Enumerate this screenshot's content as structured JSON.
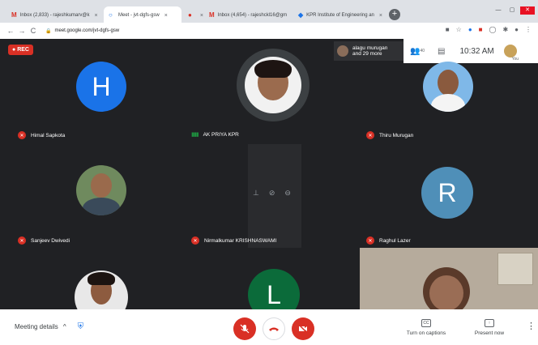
{
  "browser": {
    "tabs": [
      {
        "icon": "M",
        "title": "Inbox (2,833) - rajeshkumarv@k",
        "close": "×"
      },
      {
        "icon": "○",
        "title": "Meet - jvt-dgfs-gsw",
        "close": "×",
        "active": true
      },
      {
        "icon": "●",
        "title": "",
        "close": "×"
      },
      {
        "icon": "M",
        "title": "Inbox (4,654) - rajeshckl16@gm",
        "close": "×"
      },
      {
        "icon": "◆",
        "title": "KPR Institute of Engineering an",
        "close": "×"
      }
    ],
    "new_tab": "+",
    "window_controls": {
      "minimize": "—",
      "maximize": "▢",
      "close": "✕"
    },
    "nav": {
      "back": "←",
      "forward": "→",
      "reload": "C"
    },
    "url": "meet.google.com/jvt-dgfs-gsw",
    "lock": "🔒"
  },
  "meet": {
    "rec_label": "REC",
    "participants_box": {
      "line1": "alagu murugan",
      "line2": "and 29 more"
    },
    "people_count": "40",
    "time": "10:32 AM",
    "you_label": "You",
    "tiles": [
      {
        "name": "Himal Sapkota",
        "initial": "H",
        "avatar_color": "#1a73e8",
        "muted": true
      },
      {
        "name": "AK PRIYA KPR",
        "photo": true,
        "speaking": true
      },
      {
        "name": "Thiru Murugan",
        "photo": true,
        "muted": true
      },
      {
        "name": "Sanjeev Dwivedi",
        "photo": true,
        "muted": true
      },
      {
        "name": "Nirmalkumar KRISHNASWAMI",
        "muted": true
      },
      {
        "name": "Raghul Lazer",
        "initial": "R",
        "avatar_color": "#4f8fb8",
        "muted": true
      },
      {
        "name": "",
        "photo": true
      },
      {
        "name": "",
        "initial": "L",
        "avatar_color": "#0b6b3a"
      },
      {
        "name": "",
        "photo": true,
        "video": true
      }
    ]
  },
  "bottom": {
    "meeting_details": "Meeting details",
    "chevron": "^",
    "captions": "Turn on captions",
    "present": "Present now",
    "more": "⋮"
  },
  "colors": {
    "red": "#d93025",
    "dark": "#202124",
    "blue": "#1a73e8"
  }
}
